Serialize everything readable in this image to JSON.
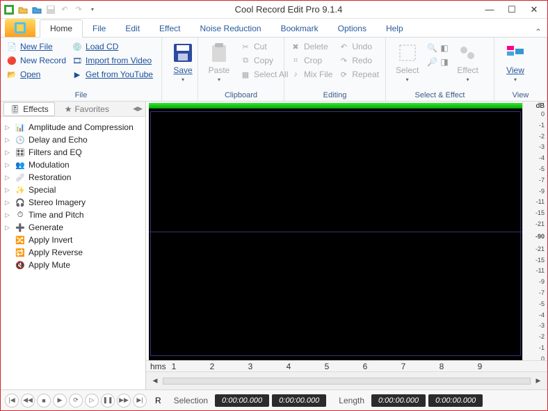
{
  "app": {
    "title": "Cool Record Edit Pro 9.1.4"
  },
  "tabs": [
    "Home",
    "File",
    "Edit",
    "Effect",
    "Noise Reduction",
    "Bookmark",
    "Options",
    "Help"
  ],
  "tabs_active": 0,
  "ribbon": {
    "groups": {
      "file": {
        "label": "File",
        "new_file": "New File",
        "new_record": "New Record",
        "open": "Open",
        "load_cd": "Load CD",
        "import_video": "Import from Video",
        "get_youtube": "Get from YouTube",
        "save": "Save"
      },
      "clipboard": {
        "label": "Clipboard",
        "paste": "Paste",
        "cut": "Cut",
        "copy": "Copy",
        "select_all": "Select All"
      },
      "editing": {
        "label": "Editing",
        "delete": "Delete",
        "crop": "Crop",
        "mix_file": "Mix File",
        "undo": "Undo",
        "redo": "Redo",
        "repeat": "Repeat"
      },
      "select_effect": {
        "label": "Select & Effect",
        "select": "Select",
        "effect": "Effect"
      },
      "view": {
        "label": "View",
        "view": "View"
      }
    }
  },
  "sidebar": {
    "tab_effects": "Effects",
    "tab_favorites": "Favorites",
    "nodes": [
      {
        "label": "Amplitude and Compression",
        "expandable": true,
        "icon": "amp"
      },
      {
        "label": "Delay and Echo",
        "expandable": true,
        "icon": "delay"
      },
      {
        "label": "Filters and EQ",
        "expandable": true,
        "icon": "eq"
      },
      {
        "label": "Modulation",
        "expandable": true,
        "icon": "mod"
      },
      {
        "label": "Restoration",
        "expandable": true,
        "icon": "rest"
      },
      {
        "label": "Special",
        "expandable": true,
        "icon": "spec"
      },
      {
        "label": "Stereo Imagery",
        "expandable": true,
        "icon": "stereo"
      },
      {
        "label": "Time and Pitch",
        "expandable": true,
        "icon": "time"
      },
      {
        "label": "Generate",
        "expandable": true,
        "icon": "gen"
      },
      {
        "label": "Apply Invert",
        "expandable": false,
        "icon": "inv"
      },
      {
        "label": "Apply Reverse",
        "expandable": false,
        "icon": "rev"
      },
      {
        "label": "Apply Mute",
        "expandable": false,
        "icon": "mute"
      }
    ]
  },
  "dbscale": {
    "header": "dB",
    "top": [
      "0",
      "-1",
      "-2",
      "-3",
      "-4",
      "-5",
      "-7",
      "-9",
      "-11",
      "-15",
      "-21"
    ],
    "center": "-90",
    "bottom": [
      "-21",
      "-15",
      "-11",
      "-9",
      "-7",
      "-5",
      "-4",
      "-3",
      "-2",
      "-1",
      "0"
    ]
  },
  "ruler": {
    "unit": "hms",
    "marks": [
      "1",
      "2",
      "3",
      "4",
      "5",
      "6",
      "7",
      "8",
      "9"
    ]
  },
  "status": {
    "selection_label": "Selection",
    "length_label": "Length",
    "sel_start": "0:00:00.000",
    "sel_end": "0:00:00.000",
    "len_a": "0:00:00.000",
    "len_b": "0:00:00.000",
    "rec_label": "R"
  }
}
